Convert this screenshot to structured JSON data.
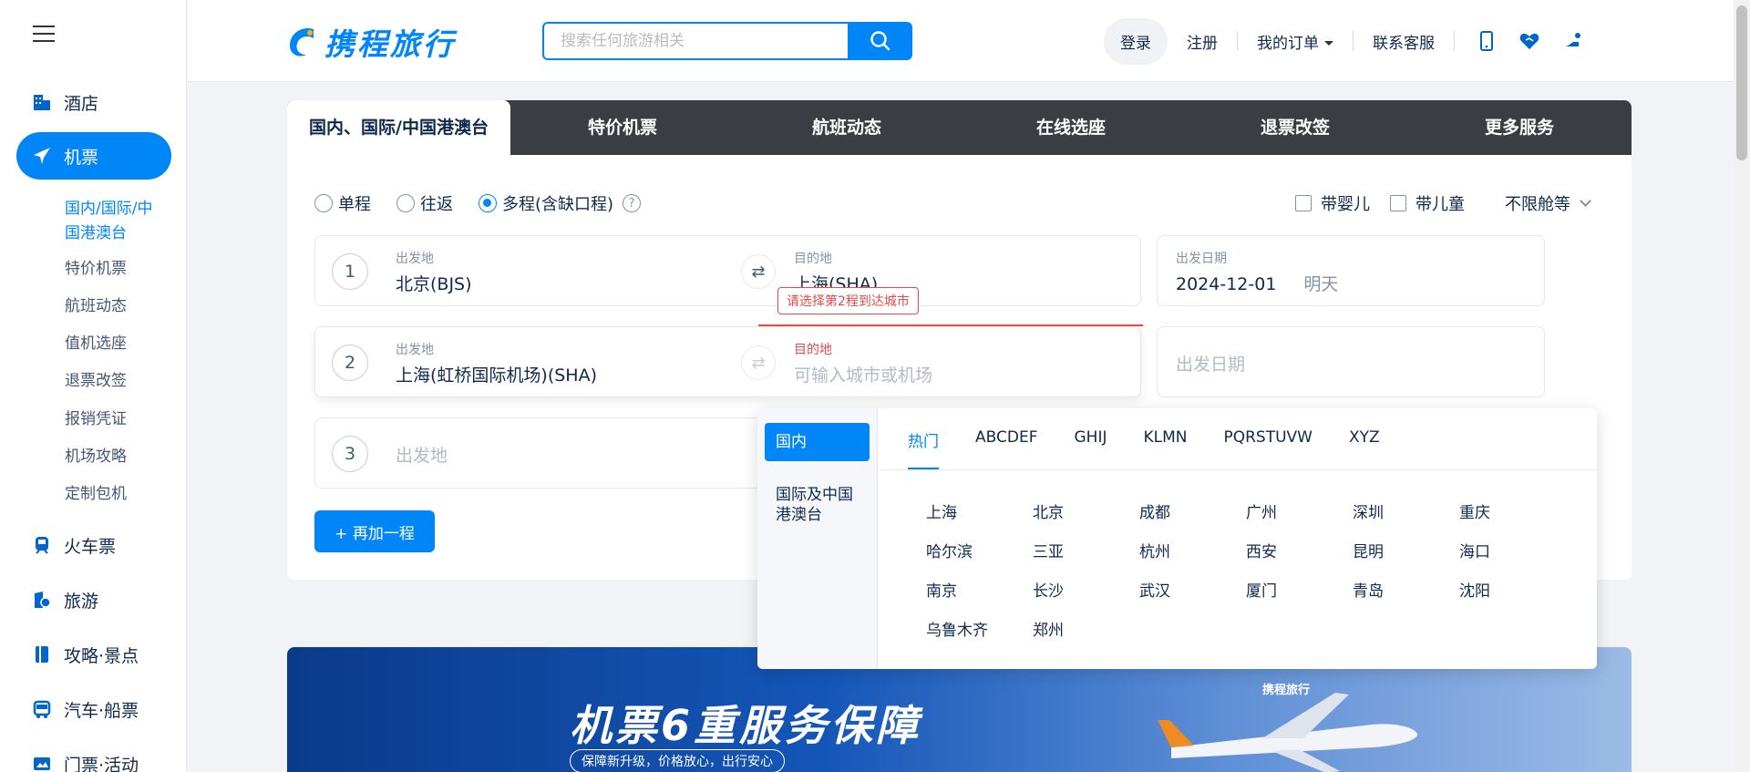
{
  "sidebar": {
    "items": [
      {
        "label": "酒店",
        "icon": "hotel-icon"
      },
      {
        "label": "机票",
        "icon": "plane-icon",
        "active": true
      },
      {
        "label": "火车票",
        "icon": "train-icon"
      },
      {
        "label": "旅游",
        "icon": "travel-icon"
      },
      {
        "label": "攻略·景点",
        "icon": "guide-icon"
      },
      {
        "label": "汽车·船票",
        "icon": "bus-icon"
      },
      {
        "label": "门票·活动",
        "icon": "ticket-icon"
      }
    ],
    "flight_subitems": [
      "国内/国际/中国港澳台",
      "特价机票",
      "航班动态",
      "值机选座",
      "退票改签",
      "报销凭证",
      "机场攻略",
      "定制包机"
    ]
  },
  "header": {
    "logo_text": "携程旅行",
    "search_placeholder": "搜索任何旅游相关",
    "login": "登录",
    "register": "注册",
    "orders": "我的订单",
    "service": "联系客服"
  },
  "booking": {
    "tabs": [
      "国内、国际/中国港澳台",
      "特价机票",
      "航班动态",
      "在线选座",
      "退票改签",
      "更多服务"
    ],
    "trip_types": [
      "单程",
      "往返",
      "多程(含缺口程)"
    ],
    "selected_trip": "多程(含缺口程)",
    "help_glyph": "?",
    "options": {
      "infant": "带婴儿",
      "child": "带儿童",
      "cabin": "不限舱等"
    },
    "legs": [
      {
        "num": "1",
        "from_label": "出发地",
        "from": "北京(BJS)",
        "to_label": "目的地",
        "to": "上海(SHA)",
        "date_label": "出发日期",
        "date": "2024-12-01",
        "date_note": "明天"
      },
      {
        "num": "2",
        "from_label": "出发地",
        "from": "上海(虹桥国际机场)(SHA)",
        "to_label": "目的地",
        "to_placeholder": "可输入城市或机场",
        "date_placeholder": "出发日期"
      },
      {
        "num": "3",
        "from_placeholder": "出发地"
      }
    ],
    "error_tip": "请选择第2程到达城市",
    "add_leg": "+ 再加一程"
  },
  "city_picker": {
    "regions": [
      "国内",
      "国际及中国港澳台"
    ],
    "tabs": [
      "热门",
      "ABCDEF",
      "GHIJ",
      "KLMN",
      "PQRSTUVW",
      "XYZ"
    ],
    "cities": [
      "上海",
      "北京",
      "成都",
      "广州",
      "深圳",
      "重庆",
      "哈尔滨",
      "三亚",
      "杭州",
      "西安",
      "昆明",
      "海口",
      "南京",
      "长沙",
      "武汉",
      "厦门",
      "青岛",
      "沈阳",
      "乌鲁木齐",
      "郑州"
    ]
  },
  "banner": {
    "title": "机票6重服务保障",
    "subtitle": "保障新升级，价格放心，出行安心",
    "logo": "携程旅行"
  },
  "colors": {
    "accent": "#0086f6",
    "error": "#e64a4a",
    "tab_bar": "#3a3d42"
  }
}
